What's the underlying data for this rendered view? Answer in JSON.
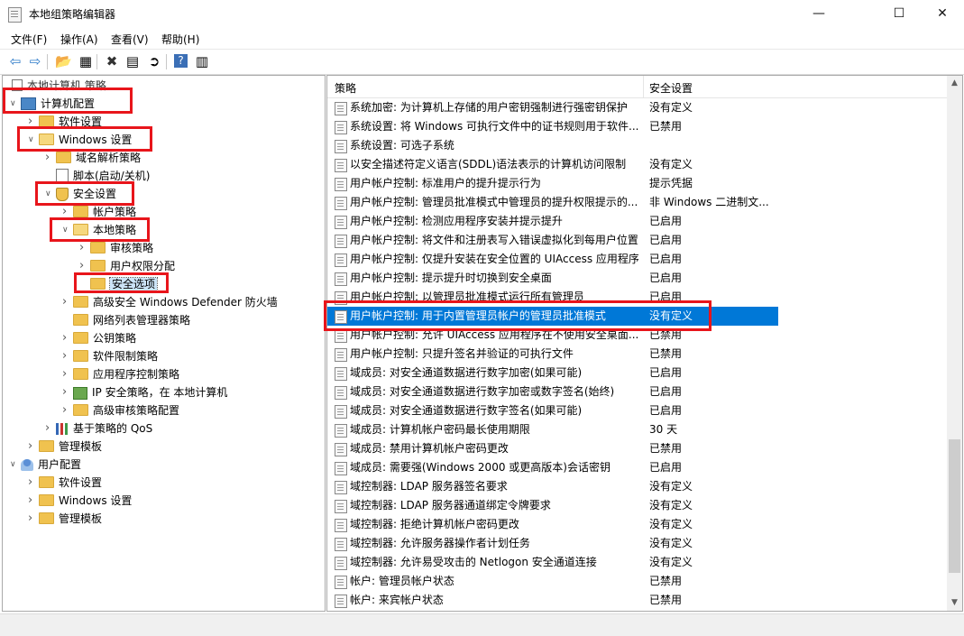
{
  "window": {
    "title": "本地组策略编辑器",
    "minimize": "—",
    "maximize": "☐",
    "close": "✕"
  },
  "menu": [
    "文件(F)",
    "操作(A)",
    "查看(V)",
    "帮助(H)"
  ],
  "toolbar": {
    "icons": [
      "back-arrow-icon",
      "forward-arrow-icon",
      "up-folder-icon",
      "show-hide-tree-icon",
      "delete-icon",
      "properties-icon",
      "export-list-icon",
      "help-icon",
      "view-icon"
    ],
    "glyphs": [
      "⇦",
      "⇨",
      "📂",
      "▦",
      "✖",
      "▤",
      "➲",
      "?",
      "▥"
    ]
  },
  "tree": {
    "root": "本地计算机 策略",
    "items": [
      {
        "label": "计算机配置",
        "level": 0,
        "arrow": "v",
        "icon": "pc"
      },
      {
        "label": "软件设置",
        "level": 1,
        "arrow": ">",
        "icon": "folder"
      },
      {
        "label": "Windows 设置",
        "level": 1,
        "arrow": "v",
        "icon": "folder-open"
      },
      {
        "label": "域名解析策略",
        "level": 2,
        "arrow": ">",
        "icon": "folder"
      },
      {
        "label": "脚本(启动/关机)",
        "level": 2,
        "arrow": "",
        "icon": "doc"
      },
      {
        "label": "安全设置",
        "level": 2,
        "arrow": "v",
        "icon": "shield"
      },
      {
        "label": "帐户策略",
        "level": 3,
        "arrow": ">",
        "icon": "folder"
      },
      {
        "label": "本地策略",
        "level": 3,
        "arrow": "v",
        "icon": "folder-open"
      },
      {
        "label": "审核策略",
        "level": 4,
        "arrow": ">",
        "icon": "folder"
      },
      {
        "label": "用户权限分配",
        "level": 4,
        "arrow": ">",
        "icon": "folder"
      },
      {
        "label": "安全选项",
        "level": 4,
        "arrow": "",
        "icon": "folder",
        "selected": true
      },
      {
        "label": "高级安全 Windows Defender 防火墙",
        "level": 3,
        "arrow": ">",
        "icon": "folder"
      },
      {
        "label": "网络列表管理器策略",
        "level": 3,
        "arrow": "",
        "icon": "folder"
      },
      {
        "label": "公钥策略",
        "level": 3,
        "arrow": ">",
        "icon": "folder"
      },
      {
        "label": "软件限制策略",
        "level": 3,
        "arrow": ">",
        "icon": "folder"
      },
      {
        "label": "应用程序控制策略",
        "level": 3,
        "arrow": ">",
        "icon": "folder"
      },
      {
        "label": "IP 安全策略，在 本地计算机",
        "level": 3,
        "arrow": ">",
        "icon": "net"
      },
      {
        "label": "高级审核策略配置",
        "level": 3,
        "arrow": ">",
        "icon": "folder"
      },
      {
        "label": "基于策略的 QoS",
        "level": 2,
        "arrow": ">",
        "icon": "chart"
      },
      {
        "label": "管理模板",
        "level": 1,
        "arrow": ">",
        "icon": "folder"
      },
      {
        "label": "用户配置",
        "level": 0,
        "arrow": "v",
        "icon": "user"
      },
      {
        "label": "软件设置",
        "level": 1,
        "arrow": ">",
        "icon": "folder"
      },
      {
        "label": "Windows 设置",
        "level": 1,
        "arrow": ">",
        "icon": "folder"
      },
      {
        "label": "管理模板",
        "level": 1,
        "arrow": ">",
        "icon": "folder"
      }
    ]
  },
  "list": {
    "col_policy": "策略",
    "col_setting": "安全设置",
    "sort_indicator": "^",
    "rows": [
      {
        "name": "系统加密: 为计算机上存储的用户密钥强制进行强密钥保护",
        "setting": "没有定义"
      },
      {
        "name": "系统设置: 将 Windows 可执行文件中的证书规则用于软件...",
        "setting": "已禁用"
      },
      {
        "name": "系统设置: 可选子系统",
        "setting": ""
      },
      {
        "name": "以安全描述符定义语言(SDDL)语法表示的计算机访问限制",
        "setting": "没有定义"
      },
      {
        "name": "用户帐户控制: 标准用户的提升提示行为",
        "setting": "提示凭据"
      },
      {
        "name": "用户帐户控制: 管理员批准模式中管理员的提升权限提示的...",
        "setting": "非 Windows 二进制文..."
      },
      {
        "name": "用户帐户控制: 检测应用程序安装并提示提升",
        "setting": "已启用"
      },
      {
        "name": "用户帐户控制: 将文件和注册表写入错误虚拟化到每用户位置",
        "setting": "已启用"
      },
      {
        "name": "用户帐户控制: 仅提升安装在安全位置的 UIAccess 应用程序",
        "setting": "已启用"
      },
      {
        "name": "用户帐户控制: 提示提升时切换到安全桌面",
        "setting": "已启用"
      },
      {
        "name": "用户帐户控制: 以管理员批准模式运行所有管理员",
        "setting": "已启用"
      },
      {
        "name": "用户帐户控制: 用于内置管理员帐户的管理员批准模式",
        "setting": "没有定义",
        "selected": true
      },
      {
        "name": "用户帐户控制: 允许 UIAccess 应用程序在不使用安全桌面...",
        "setting": "已禁用"
      },
      {
        "name": "用户帐户控制: 只提升签名并验证的可执行文件",
        "setting": "已禁用"
      },
      {
        "name": "域成员: 对安全通道数据进行数字加密(如果可能)",
        "setting": "已启用"
      },
      {
        "name": "域成员: 对安全通道数据进行数字加密或数字签名(始终)",
        "setting": "已启用"
      },
      {
        "name": "域成员: 对安全通道数据进行数字签名(如果可能)",
        "setting": "已启用"
      },
      {
        "name": "域成员: 计算机帐户密码最长使用期限",
        "setting": "30 天"
      },
      {
        "name": "域成员: 禁用计算机帐户密码更改",
        "setting": "已禁用"
      },
      {
        "name": "域成员: 需要强(Windows 2000 或更高版本)会话密钥",
        "setting": "已启用"
      },
      {
        "name": "域控制器: LDAP 服务器签名要求",
        "setting": "没有定义"
      },
      {
        "name": "域控制器: LDAP 服务器通道绑定令牌要求",
        "setting": "没有定义"
      },
      {
        "name": "域控制器: 拒绝计算机帐户密码更改",
        "setting": "没有定义"
      },
      {
        "name": "域控制器: 允许服务器操作者计划任务",
        "setting": "没有定义"
      },
      {
        "name": "域控制器: 允许易受攻击的 Netlogon 安全通道连接",
        "setting": "没有定义"
      },
      {
        "name": "帐户: 管理员帐户状态",
        "setting": "已禁用"
      },
      {
        "name": "帐户: 来宾帐户状态",
        "setting": "已禁用"
      }
    ]
  },
  "colors": {
    "selection": "#0078d7",
    "annotation": "#e8151b"
  }
}
